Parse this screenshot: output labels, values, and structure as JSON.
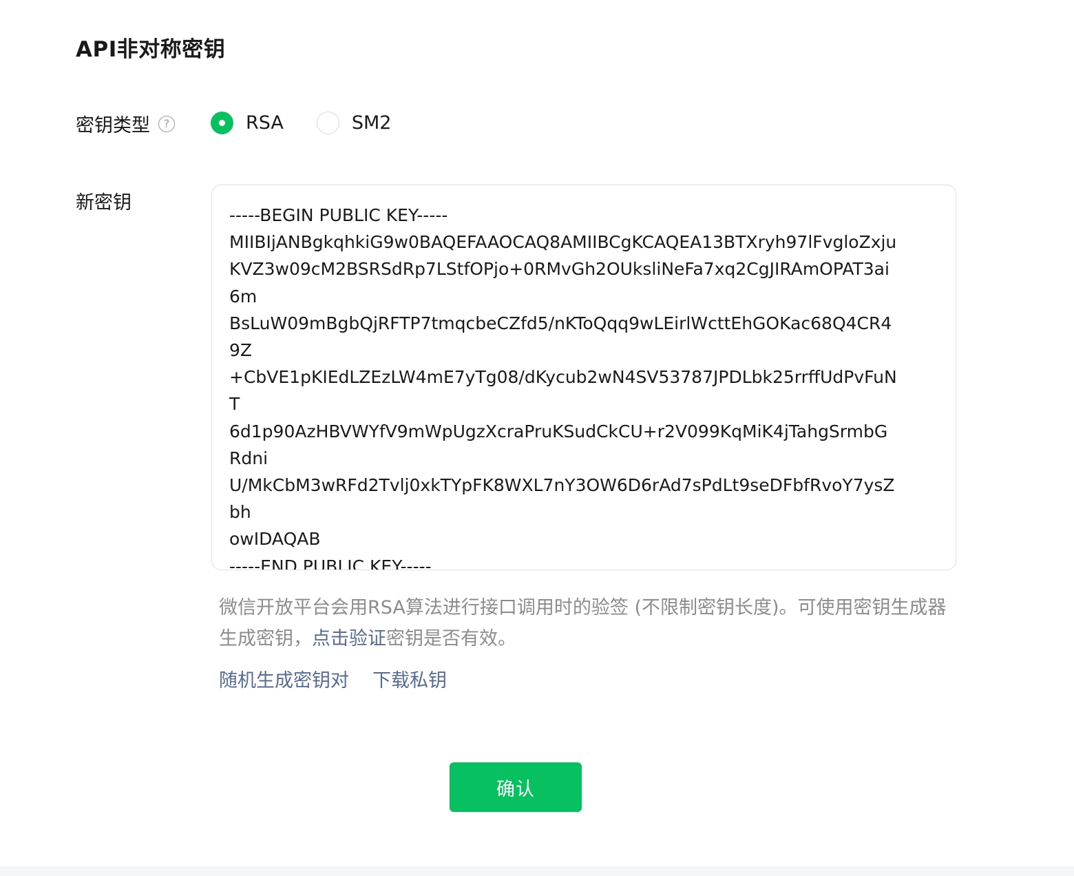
{
  "page_title": "API非对称密钥",
  "key_type": {
    "label": "密钥类型",
    "help_glyph": "?",
    "options": [
      {
        "label": "RSA",
        "checked": true
      },
      {
        "label": "SM2",
        "checked": false
      }
    ]
  },
  "new_key": {
    "label": "新密钥",
    "lines": [
      "-----BEGIN PUBLIC KEY-----",
      "MIIBIjANBgkqhkiG9w0BAQEFAAOCAQ8AMIIBCgKCAQEA13BTXryh97lFvgloZxju",
      "KVZ3w09cM2BSRSdRp7LStfOPjo+0RMvGh2OUksliNeFa7xq2CgJIRAmOPAT3ai",
      "6m",
      "BsLuW09mBgbQjRFTP7tmqcbeCZfd5/nKToQqq9wLEirlWcttEhGOKac68Q4CR4",
      "9Z",
      "+CbVE1pKIEdLZEzLW4mE7yTg08/dKycub2wN4SV53787JPDLbk25rrffUdPvFuN",
      "T",
      "6d1p90AzHBVWYfV9mWpUgzXcraPruKSudCkCU+r2V099KqMiK4jTahgSrmbG",
      "Rdni",
      "U/MkCbM3wRFd2Tvlj0xkTYpFK8WXL7nY3OW6D6rAd7sPdLt9seDFbfRvoY7ysZ",
      "bh",
      "owIDAQAB",
      "-----END PUBLIC KEY-----"
    ]
  },
  "hint": {
    "text_before": "微信开放平台会用RSA算法进行接口调用时的验签 (不限制密钥长度)。可使用密钥生成器生成密钥，",
    "verify_link": "点击验证",
    "text_after": "密钥是否有效。"
  },
  "actions": {
    "generate_pair": "随机生成密钥对",
    "download_private": "下载私钥"
  },
  "confirm_label": "确认",
  "colors": {
    "brand_green": "#07c160",
    "link_blue": "#576b95",
    "hint_gray": "#8c8c8c"
  }
}
